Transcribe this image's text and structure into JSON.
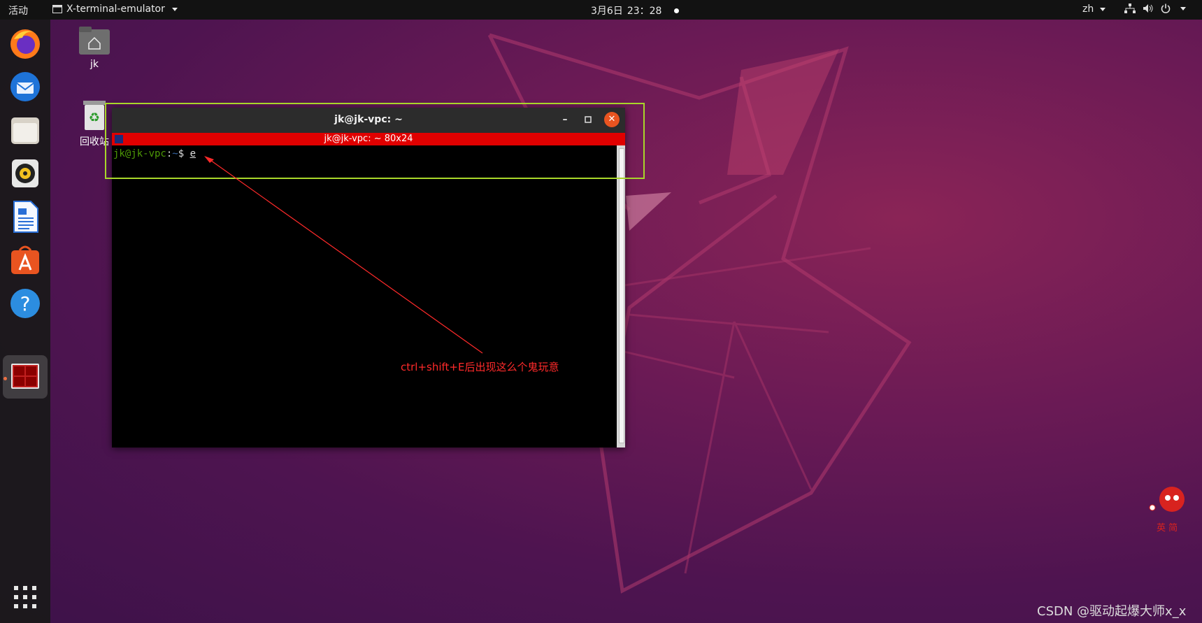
{
  "topbar": {
    "activities": "活动",
    "app_menu": "X-terminal-emulator",
    "date": "3月6日",
    "time": "23：28",
    "language": "zh"
  },
  "dock": {
    "items": [
      "firefox",
      "thunderbird",
      "files",
      "rhythmbox",
      "libreoffice-writer",
      "ubuntu-software",
      "help",
      "terminal"
    ],
    "active": "terminal"
  },
  "desktop": {
    "icons": [
      {
        "label": "jk"
      },
      {
        "label": "回收站"
      }
    ]
  },
  "window": {
    "title": "jk@jk-vpc: ~",
    "xterm_title": "jk@jk-vpc: ~ 80x24",
    "prompt_user": "jk@jk-vpc",
    "prompt_sep": ":",
    "prompt_path": "~",
    "prompt_dollar": "$ ",
    "typed": "e"
  },
  "annotation": {
    "text": "ctrl+shift+E后出现这么个鬼玩意",
    "color": "#ff2a2a",
    "box_color": "#a8d62a"
  },
  "watermark": "CSDN @驱动起爆大师x_x",
  "mascot_text": "英 简"
}
